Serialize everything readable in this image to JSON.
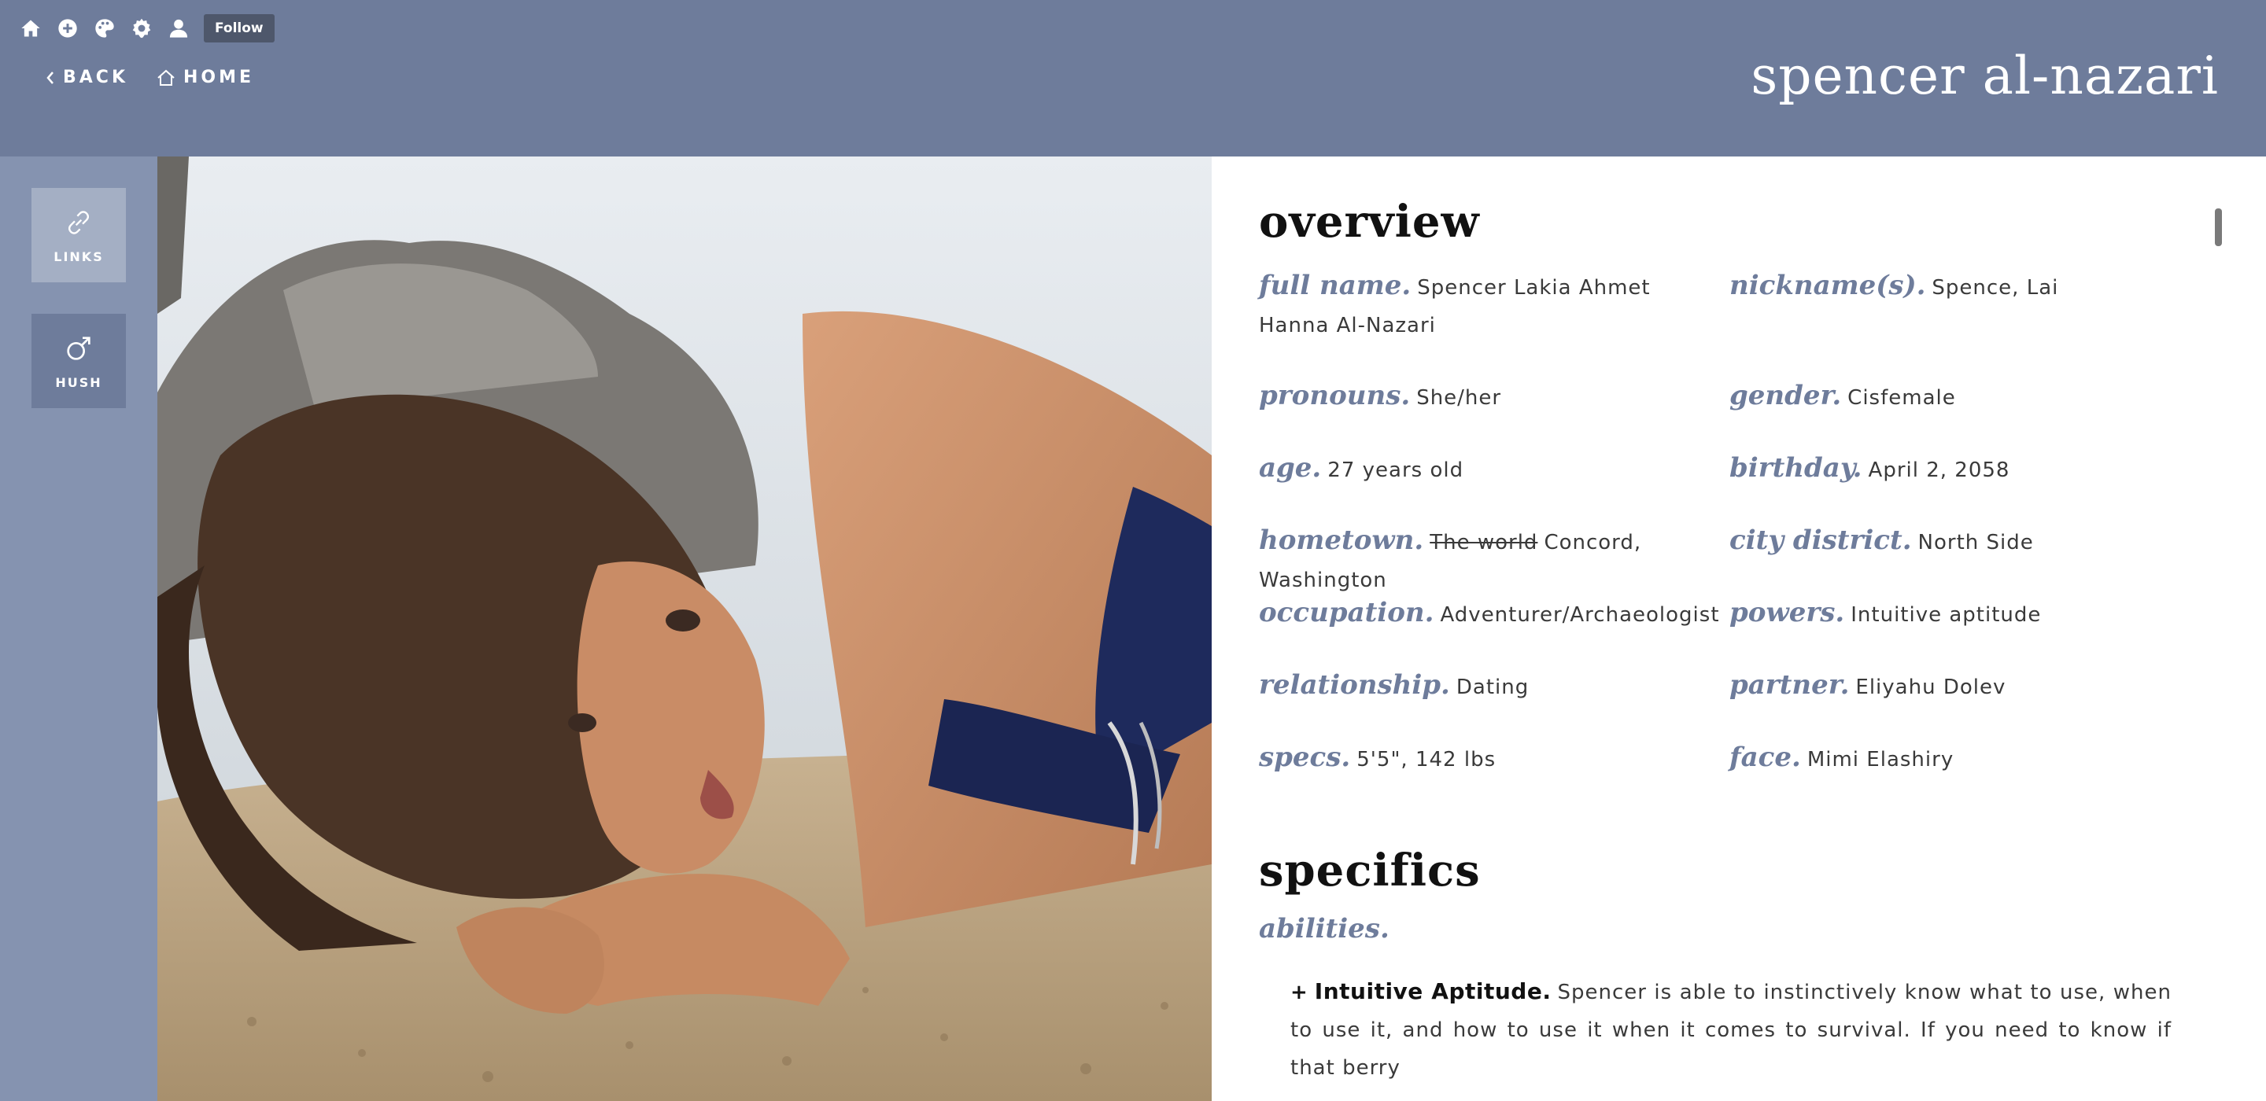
{
  "toolbar": {
    "icons": [
      "home-icon",
      "plus-circle-icon",
      "palette-icon",
      "gear-icon",
      "user-icon"
    ],
    "follow_label": "Follow"
  },
  "nav": {
    "back_label": "BACK",
    "home_label": "HOME"
  },
  "site_title": "spencer al-nazari",
  "rail": {
    "links_label": "LINKS",
    "hush_label": "HUSH"
  },
  "overview": {
    "heading": "overview",
    "fields": {
      "full_name": {
        "label": "full name.",
        "value": "Spencer Lakia Ahmet Hanna Al-Nazari"
      },
      "nickname": {
        "label": "nickname(s).",
        "value": "Spence, Lai"
      },
      "pronouns": {
        "label": "pronouns.",
        "value": "She/her"
      },
      "gender": {
        "label": "gender.",
        "value": "Cisfemale"
      },
      "age": {
        "label": "age.",
        "value": "27 years old"
      },
      "birthday": {
        "label": "birthday.",
        "value": "April 2, 2058"
      },
      "hometown": {
        "label": "hometown.",
        "struck": "The world",
        "value": "Concord, Washington"
      },
      "city_district": {
        "label": "city district.",
        "value": "North Side"
      },
      "occupation": {
        "label": "occupation.",
        "value": "Adventurer/Archaeologist"
      },
      "powers": {
        "label": "powers.",
        "value": "Intuitive aptitude"
      },
      "relationship": {
        "label": "relationship.",
        "value": "Dating"
      },
      "partner": {
        "label": "partner.",
        "value": "Eliyahu Dolev"
      },
      "specs": {
        "label": "specs.",
        "value": "5'5\", 142 lbs"
      },
      "face": {
        "label": "face.",
        "value": "Mimi Elashiry"
      }
    }
  },
  "specifics": {
    "heading": "specifics",
    "abilities_label": "abilities.",
    "ability": {
      "bullet": "+",
      "title": "Intuitive Aptitude.",
      "text": "Spencer is able to instinctively know what to use, when to use it, and how to use it when it comes to survival. If you need to know if that berry"
    }
  },
  "colors": {
    "header": "#6e7c9b",
    "rail": "#8593b0",
    "accent_label": "#6e7c9b"
  }
}
